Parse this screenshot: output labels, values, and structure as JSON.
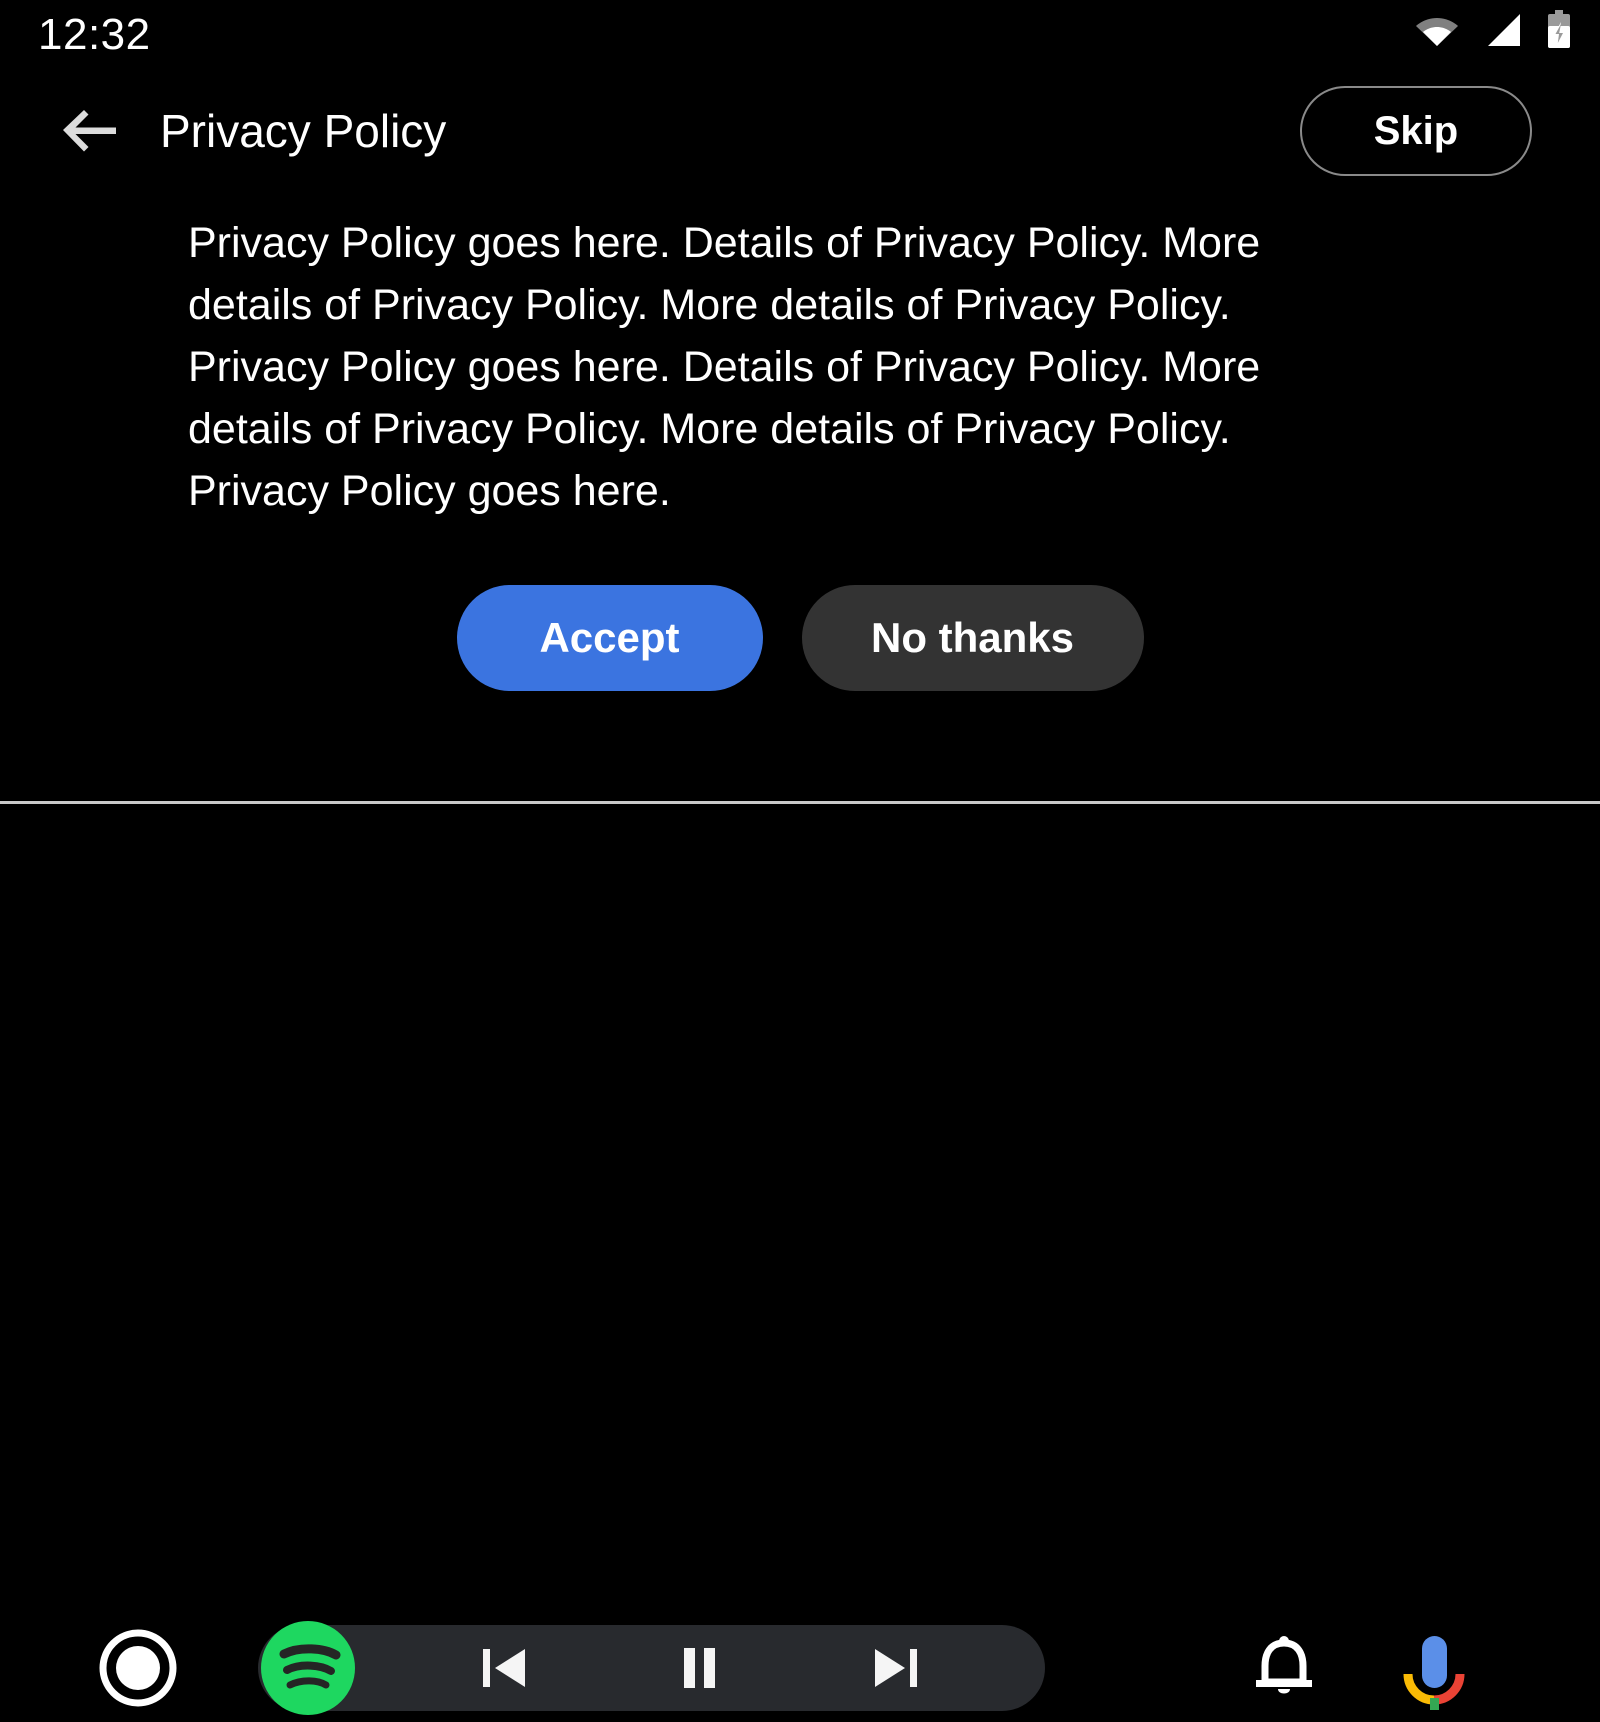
{
  "status_bar": {
    "clock": "12:32",
    "icons": {
      "wifi": "wifi-icon",
      "signal": "cell-signal-icon",
      "battery": "battery-charging-icon"
    }
  },
  "header": {
    "back_icon": "back-arrow-icon",
    "title": "Privacy Policy",
    "skip_label": "Skip"
  },
  "main": {
    "policy_text": "Privacy Policy goes here. Details of Privacy Policy. More details of Privacy Policy. More details of Privacy Policy. Privacy Policy goes here. Details of Privacy Policy. More details of Privacy Policy. More details of Privacy Policy. Privacy Policy goes here.",
    "accept_label": "Accept",
    "decline_label": "No thanks"
  },
  "nav_bar": {
    "home_icon": "home-circle-icon",
    "media_app_icon": "spotify-icon",
    "prev_icon": "skip-previous-icon",
    "play_pause_icon": "pause-icon",
    "next_icon": "skip-next-icon",
    "notifications_icon": "bell-icon",
    "assistant_icon": "google-assistant-mic-icon"
  },
  "colors": {
    "background": "#000000",
    "accept_blue": "#3b74e0",
    "decline_gray": "#333333",
    "media_pill": "#282a2e",
    "spotify_green": "#1ed760",
    "divider": "#c9c9c9",
    "text_primary": "#ffffff",
    "skip_border": "#8a8a8a"
  }
}
